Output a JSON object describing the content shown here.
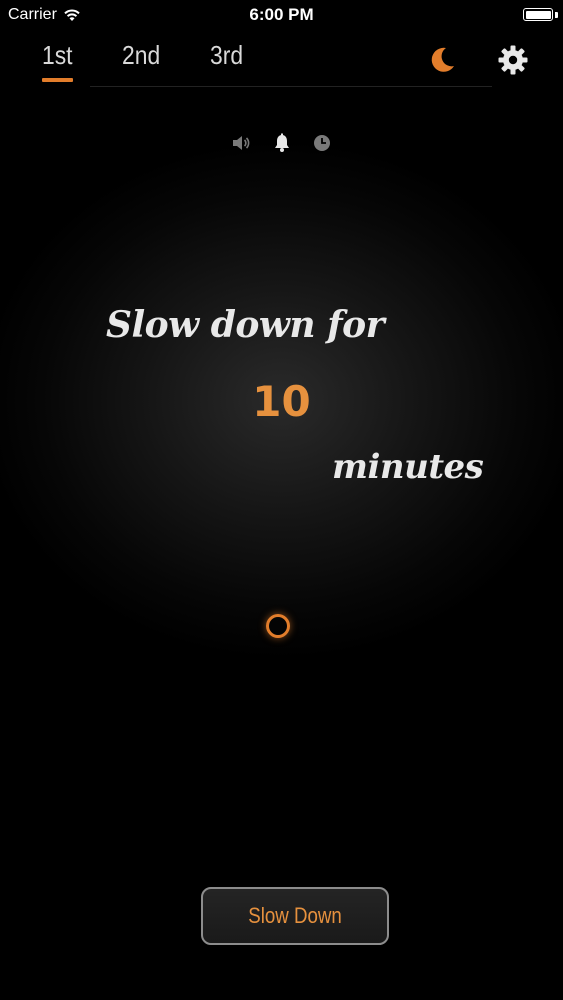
{
  "status_bar": {
    "carrier": "Carrier",
    "time": "6:00 PM",
    "icons": [
      "wifi-icon",
      "battery-icon"
    ]
  },
  "tabs": [
    {
      "label": "1st",
      "selected": true
    },
    {
      "label": "2nd",
      "selected": false
    },
    {
      "label": "3rd",
      "selected": false
    }
  ],
  "header_icons": {
    "moon": "moon-icon",
    "settings": "gear-icon"
  },
  "mode_icons": [
    "speaker-icon",
    "bell-icon",
    "clock-icon"
  ],
  "main": {
    "line1": "Slow down for",
    "minutes_value": "10",
    "line3": "minutes"
  },
  "action_button": {
    "label": "Slow Down"
  },
  "colors": {
    "accent": "#e27d2b",
    "accent_text": "#e6913e",
    "background": "#000000",
    "text": "#e8e8e8"
  }
}
